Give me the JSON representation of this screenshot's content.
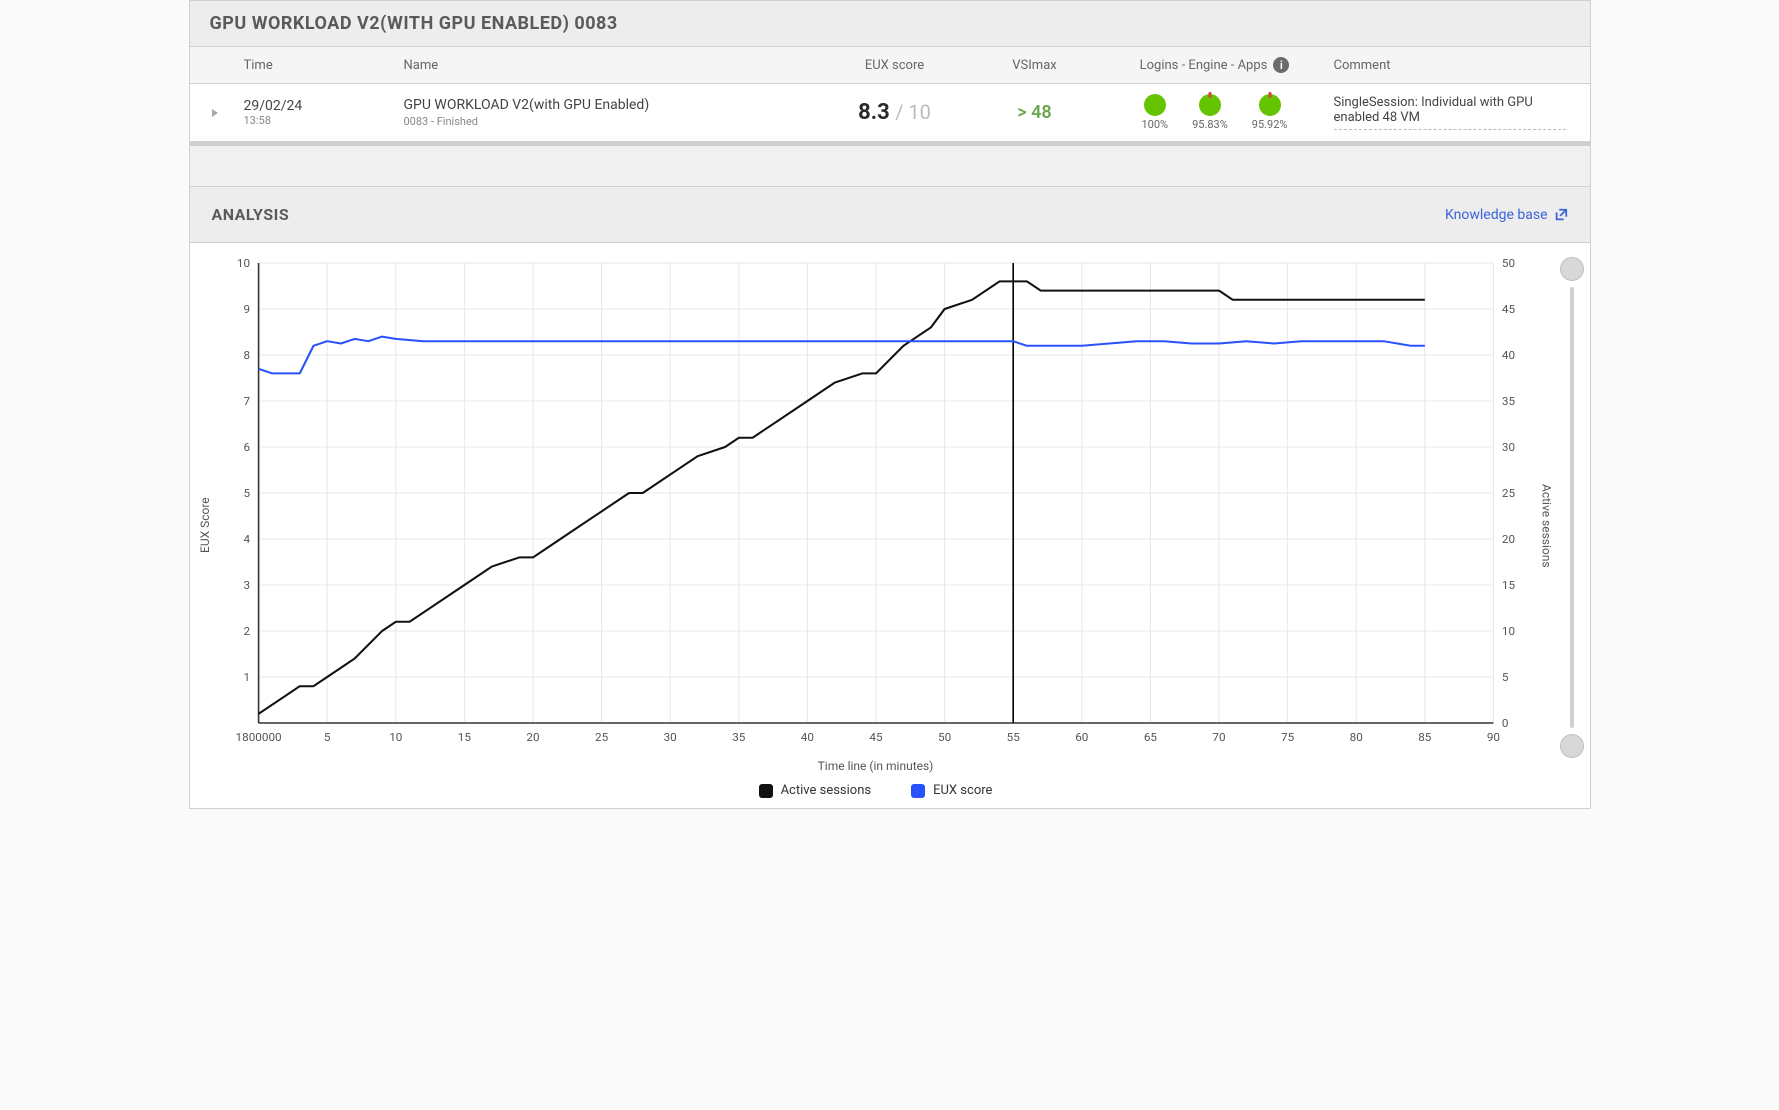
{
  "top": {
    "title": "GPU WORKLOAD V2(WITH GPU ENABLED) 0083",
    "headers": {
      "time": "Time",
      "name": "Name",
      "eux": "EUX score",
      "vsimax": "VSImax",
      "status": "Logins - Engine - Apps",
      "comment": "Comment"
    },
    "row": {
      "date": "29/02/24",
      "time": "13:58",
      "name": "GPU WORKLOAD V2(with GPU Enabled)",
      "name_sub": "0083 - Finished",
      "eux_score": "8.3",
      "eux_of": "/ 10",
      "vsimax": "> 48",
      "status": [
        {
          "label": "100%",
          "warn": false
        },
        {
          "label": "95.83%",
          "warn": true
        },
        {
          "label": "95.92%",
          "warn": true
        }
      ],
      "comment": "SingleSession: Individual with GPU enabled 48 VM"
    }
  },
  "analysis": {
    "title": "ANALYSIS",
    "knowledge_base": "Knowledge base",
    "ylabel_left": "EUX Score",
    "ylabel_right": "Active sessions",
    "xlabel": "Time line (in minutes)",
    "x_initial_tick": "1800000",
    "legend": {
      "sessions": "Active sessions",
      "eux": "EUX score"
    },
    "colors": {
      "sessions": "#111111",
      "eux": "#2952ff"
    }
  },
  "chart_data": {
    "type": "line",
    "title": "",
    "xlabel": "Time line (in minutes)",
    "ylabel_left": "EUX Score",
    "ylabel_right": "Active sessions",
    "xlim": [
      0,
      90
    ],
    "ylim_left": [
      0,
      10
    ],
    "ylim_right": [
      0,
      50
    ],
    "x_ticks": [
      0,
      5,
      10,
      15,
      20,
      25,
      30,
      35,
      40,
      45,
      50,
      55,
      60,
      65,
      70,
      75,
      80,
      85,
      90
    ],
    "y_left_ticks": [
      1,
      2,
      3,
      4,
      5,
      6,
      7,
      8,
      9,
      10
    ],
    "y_right_ticks": [
      0,
      5,
      10,
      15,
      20,
      25,
      30,
      35,
      40,
      45,
      50
    ],
    "cursor_x": 55,
    "series": [
      {
        "name": "Active sessions",
        "axis": "right",
        "color": "#111111",
        "data": [
          {
            "x": 0,
            "y": 1
          },
          {
            "x": 2,
            "y": 3
          },
          {
            "x": 3,
            "y": 4
          },
          {
            "x": 4,
            "y": 4
          },
          {
            "x": 5,
            "y": 5
          },
          {
            "x": 7,
            "y": 7
          },
          {
            "x": 9,
            "y": 10
          },
          {
            "x": 10,
            "y": 11
          },
          {
            "x": 11,
            "y": 11
          },
          {
            "x": 13,
            "y": 13
          },
          {
            "x": 15,
            "y": 15
          },
          {
            "x": 17,
            "y": 17
          },
          {
            "x": 19,
            "y": 18
          },
          {
            "x": 20,
            "y": 18
          },
          {
            "x": 22,
            "y": 20
          },
          {
            "x": 24,
            "y": 22
          },
          {
            "x": 25,
            "y": 23
          },
          {
            "x": 27,
            "y": 25
          },
          {
            "x": 28,
            "y": 25
          },
          {
            "x": 30,
            "y": 27
          },
          {
            "x": 32,
            "y": 29
          },
          {
            "x": 34,
            "y": 30
          },
          {
            "x": 35,
            "y": 31
          },
          {
            "x": 36,
            "y": 31
          },
          {
            "x": 38,
            "y": 33
          },
          {
            "x": 40,
            "y": 35
          },
          {
            "x": 42,
            "y": 37
          },
          {
            "x": 44,
            "y": 38
          },
          {
            "x": 45,
            "y": 38
          },
          {
            "x": 47,
            "y": 41
          },
          {
            "x": 49,
            "y": 43
          },
          {
            "x": 50,
            "y": 45
          },
          {
            "x": 52,
            "y": 46
          },
          {
            "x": 54,
            "y": 48
          },
          {
            "x": 55,
            "y": 48
          },
          {
            "x": 56,
            "y": 48
          },
          {
            "x": 57,
            "y": 47
          },
          {
            "x": 60,
            "y": 47
          },
          {
            "x": 65,
            "y": 47
          },
          {
            "x": 70,
            "y": 47
          },
          {
            "x": 71,
            "y": 46
          },
          {
            "x": 75,
            "y": 46
          },
          {
            "x": 80,
            "y": 46
          },
          {
            "x": 85,
            "y": 46
          }
        ]
      },
      {
        "name": "EUX score",
        "axis": "left",
        "color": "#2952ff",
        "data": [
          {
            "x": 0,
            "y": 7.7
          },
          {
            "x": 1,
            "y": 7.6
          },
          {
            "x": 2,
            "y": 7.6
          },
          {
            "x": 3,
            "y": 7.6
          },
          {
            "x": 4,
            "y": 8.2
          },
          {
            "x": 5,
            "y": 8.3
          },
          {
            "x": 6,
            "y": 8.25
          },
          {
            "x": 7,
            "y": 8.35
          },
          {
            "x": 8,
            "y": 8.3
          },
          {
            "x": 9,
            "y": 8.4
          },
          {
            "x": 10,
            "y": 8.35
          },
          {
            "x": 12,
            "y": 8.3
          },
          {
            "x": 15,
            "y": 8.3
          },
          {
            "x": 20,
            "y": 8.3
          },
          {
            "x": 25,
            "y": 8.3
          },
          {
            "x": 30,
            "y": 8.3
          },
          {
            "x": 35,
            "y": 8.3
          },
          {
            "x": 40,
            "y": 8.3
          },
          {
            "x": 45,
            "y": 8.3
          },
          {
            "x": 50,
            "y": 8.3
          },
          {
            "x": 55,
            "y": 8.3
          },
          {
            "x": 56,
            "y": 8.2
          },
          {
            "x": 58,
            "y": 8.2
          },
          {
            "x": 60,
            "y": 8.2
          },
          {
            "x": 62,
            "y": 8.25
          },
          {
            "x": 64,
            "y": 8.3
          },
          {
            "x": 66,
            "y": 8.3
          },
          {
            "x": 68,
            "y": 8.25
          },
          {
            "x": 70,
            "y": 8.25
          },
          {
            "x": 72,
            "y": 8.3
          },
          {
            "x": 74,
            "y": 8.25
          },
          {
            "x": 76,
            "y": 8.3
          },
          {
            "x": 78,
            "y": 8.3
          },
          {
            "x": 80,
            "y": 8.3
          },
          {
            "x": 82,
            "y": 8.3
          },
          {
            "x": 84,
            "y": 8.2
          },
          {
            "x": 85,
            "y": 8.2
          }
        ]
      }
    ]
  }
}
